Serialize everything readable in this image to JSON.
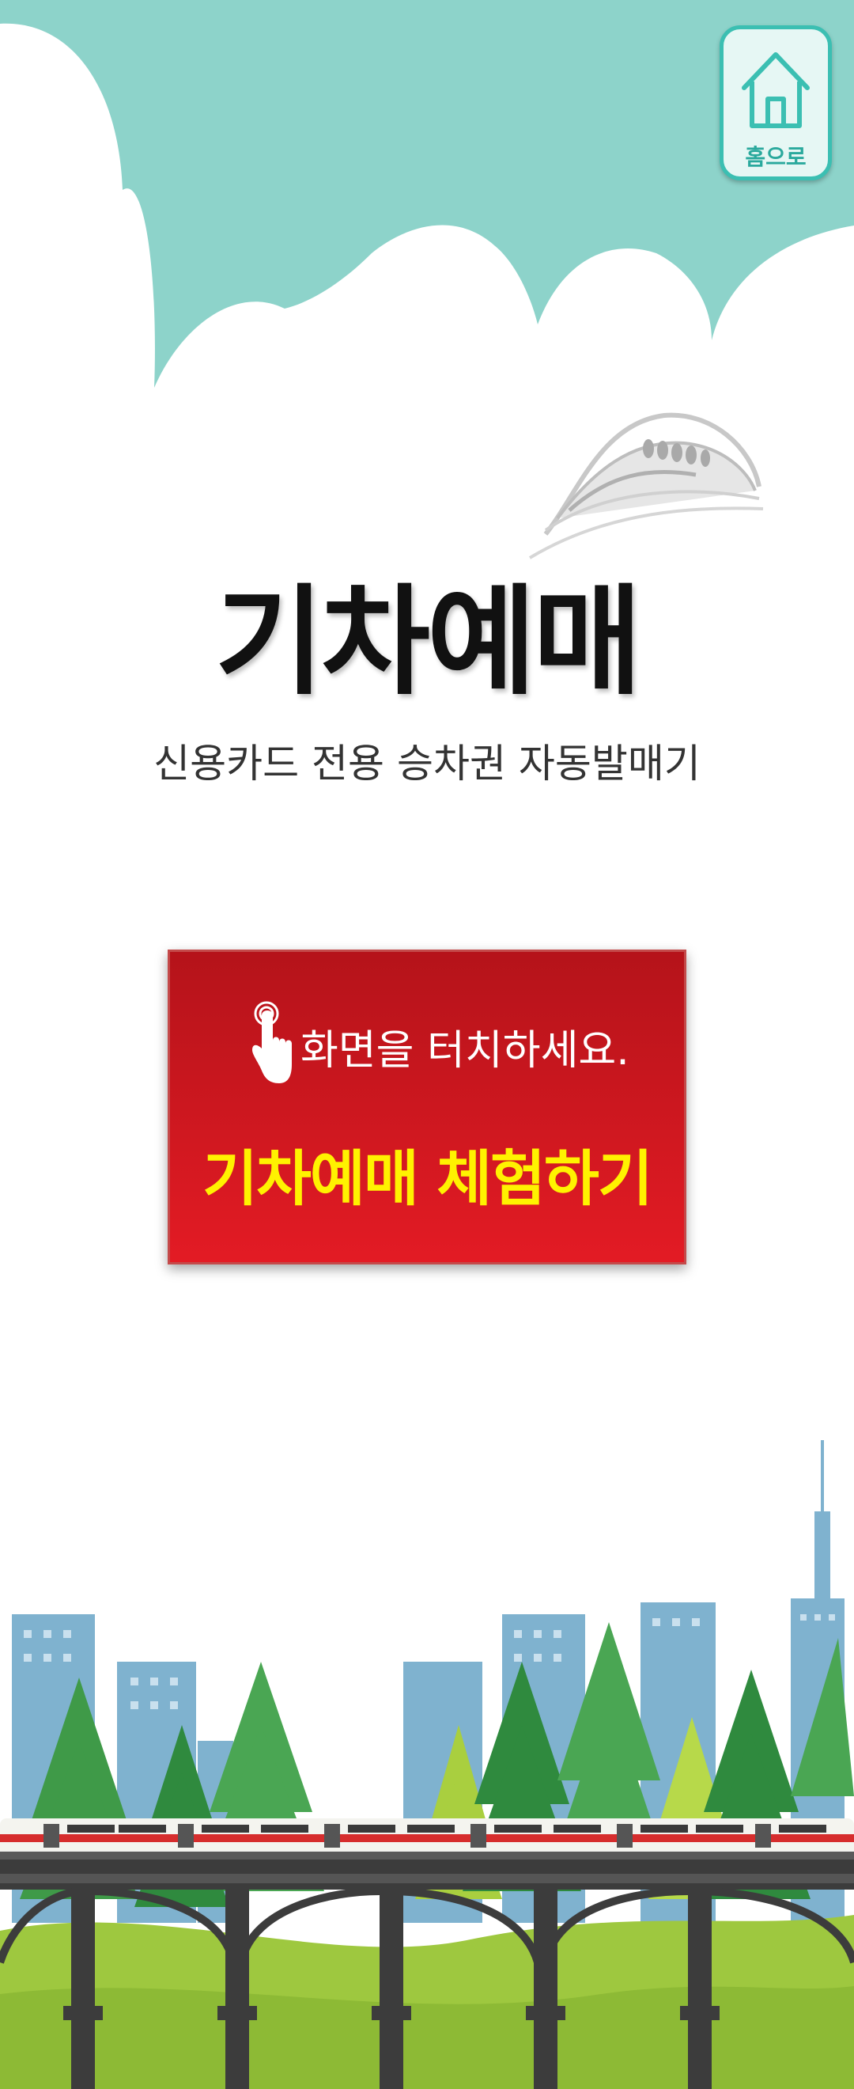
{
  "header": {
    "home_button": {
      "label": "홈으로",
      "icon": "house-icon"
    }
  },
  "main": {
    "title": "기차예매",
    "subtitle": "신용카드 전용 승차권 자동발매기",
    "start_button": {
      "touch_text": "화면을 터치하세요.",
      "cta_text": "기차예매 체험하기",
      "icon": "touch-hand-icon"
    }
  },
  "colors": {
    "sky": "#8dd3ca",
    "accent": "#3bbfb2",
    "button_red": "#d9161f",
    "cta_yellow": "#fff200"
  }
}
